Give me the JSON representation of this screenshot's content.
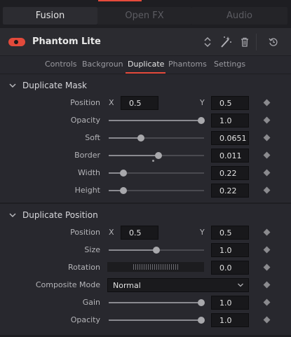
{
  "top_tabs": [
    "Fusion",
    "Open FX",
    "Audio"
  ],
  "tool": {
    "name": "Phantom Lite",
    "enabled": true
  },
  "header_icons": [
    "up-down-arrows-icon",
    "magic-wand-icon",
    "trash-icon",
    "reset-icon"
  ],
  "subtabs": [
    "Controls",
    "Background",
    "Duplicate",
    "Phantoms",
    "Settings"
  ],
  "active_subtab": "Duplicate",
  "duplicate_mask": {
    "title": "Duplicate Mask",
    "position": {
      "label": "Position",
      "x_label": "X",
      "x": "0.5",
      "y_label": "Y",
      "y": "0.5"
    },
    "opacity": {
      "label": "Opacity",
      "value": "1.0",
      "fraction": 1.0
    },
    "soft": {
      "label": "Soft",
      "value": "0.0651",
      "fraction": 0.33
    },
    "border": {
      "label": "Border",
      "value": "0.011",
      "fraction": 0.52,
      "default_fraction": 0.46
    },
    "width": {
      "label": "Width",
      "value": "0.22",
      "fraction": 0.13
    },
    "height": {
      "label": "Height",
      "value": "0.22",
      "fraction": 0.13
    }
  },
  "duplicate_position": {
    "title": "Duplicate Position",
    "position": {
      "label": "Position",
      "x_label": "X",
      "x": "0.5",
      "y_label": "Y",
      "y": "0.5"
    },
    "size": {
      "label": "Size",
      "value": "1.0",
      "fraction": 0.5
    },
    "rotation": {
      "label": "Rotation",
      "value": "0.0"
    },
    "composite_mode": {
      "label": "Composite Mode",
      "value": "Normal"
    },
    "gain": {
      "label": "Gain",
      "value": "1.0",
      "fraction": 1.0
    },
    "opacity": {
      "label": "Opacity",
      "value": "1.0",
      "fraction": 1.0
    }
  }
}
